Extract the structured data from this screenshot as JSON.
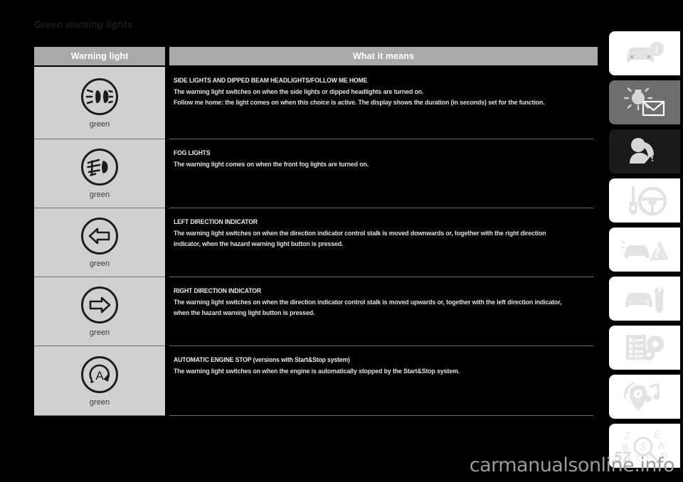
{
  "page": {
    "title": "Green warning lights",
    "page_number": "57",
    "watermark": "carmanualsonline.info"
  },
  "table": {
    "headers": {
      "warning_light": "Warning light",
      "what_it_means": "What it means"
    },
    "rows": [
      {
        "icon_name": "sidelights-dipped-beam-icon",
        "colour_label": "green",
        "title": "SIDE LIGHTS AND DIPPED BEAM HEADLIGHTS/FOLLOW ME HOME",
        "lines": [
          "The warning light switches on when the side lights or dipped headlights are turned on.",
          "Follow me home: the light comes on when this choice is active. The display shows the duration (in seconds) set for the function."
        ]
      },
      {
        "icon_name": "front-fog-lights-icon",
        "colour_label": "green",
        "title": "FOG LIGHTS",
        "lines": [
          "The warning light comes on when the front fog lights are turned on."
        ]
      },
      {
        "icon_name": "left-direction-indicator-icon",
        "colour_label": "green",
        "title": "LEFT DIRECTION INDICATOR",
        "lines": [
          "The warning light switches on when the direction indicator control stalk is moved downwards or, together with the right direction indicator, when the hazard warning light button is pressed."
        ]
      },
      {
        "icon_name": "right-direction-indicator-icon",
        "colour_label": "green",
        "title": "RIGHT DIRECTION INDICATOR",
        "lines": [
          "The warning light switches on when the direction indicator control stalk is moved upwards or, together with the left direction indicator, when the hazard warning light button is pressed."
        ]
      },
      {
        "icon_name": "automatic-engine-stop-icon",
        "colour_label": "green",
        "title": "AUTOMATIC ENGINE STOP (versions with Start&Stop system)",
        "lines": [
          "The warning light switches on when the engine is automatically stopped by the Start&Stop system."
        ]
      }
    ]
  },
  "sidebar": {
    "tabs": [
      {
        "icon_name": "car-info-icon",
        "style": "light"
      },
      {
        "icon_name": "lights-and-wipers-icon",
        "style": "mid"
      },
      {
        "icon_name": "safety-airbag-icon",
        "style": "dark"
      },
      {
        "icon_name": "key-steering-icon",
        "style": "light"
      },
      {
        "icon_name": "emergency-warning-icon",
        "style": "light"
      },
      {
        "icon_name": "maintenance-care-icon",
        "style": "light"
      },
      {
        "icon_name": "technical-specs-icon",
        "style": "light"
      },
      {
        "icon_name": "multimedia-icon",
        "style": "light"
      },
      {
        "icon_name": "alphabetical-index-icon",
        "style": "light"
      }
    ]
  },
  "colors": {
    "background": "#000000",
    "header_bar": "#a9a9ac",
    "icon_cell": "#cfd0d2",
    "text": "#e9e9e9",
    "warning_colour": "green"
  }
}
